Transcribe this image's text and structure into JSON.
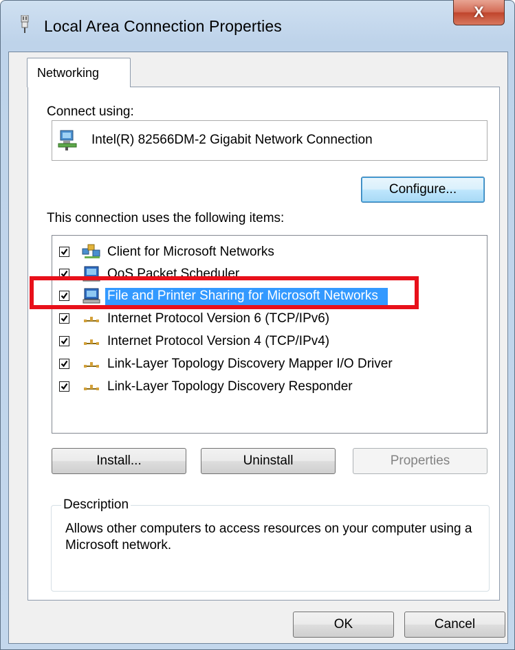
{
  "window": {
    "title": "Local Area Connection Properties",
    "close_glyph": "X"
  },
  "tabs": [
    {
      "label": "Networking",
      "selected": true
    }
  ],
  "connect_using": {
    "label": "Connect using:",
    "adapter": "Intel(R) 82566DM-2 Gigabit Network Connection",
    "configure_button": "Configure..."
  },
  "items_section": {
    "label": "This connection uses the following items:",
    "items": [
      {
        "label": "Client for Microsoft Networks",
        "checked": true,
        "icon": "network-client-icon",
        "selected": false
      },
      {
        "label": "QoS Packet Scheduler",
        "checked": true,
        "icon": "network-service-icon",
        "selected": false
      },
      {
        "label": "File and Printer Sharing for Microsoft Networks",
        "checked": true,
        "icon": "network-service-icon",
        "selected": true
      },
      {
        "label": "Internet Protocol Version 6 (TCP/IPv6)",
        "checked": true,
        "icon": "network-protocol-icon",
        "selected": false
      },
      {
        "label": "Internet Protocol Version 4 (TCP/IPv4)",
        "checked": true,
        "icon": "network-protocol-icon",
        "selected": false
      },
      {
        "label": "Link-Layer Topology Discovery Mapper I/O Driver",
        "checked": true,
        "icon": "network-protocol-icon",
        "selected": false
      },
      {
        "label": "Link-Layer Topology Discovery Responder",
        "checked": true,
        "icon": "network-protocol-icon",
        "selected": false
      }
    ]
  },
  "item_buttons": {
    "install": "Install...",
    "uninstall": "Uninstall",
    "properties": "Properties",
    "properties_enabled": false
  },
  "description": {
    "legend": "Description",
    "text": "Allows other computers to access resources on your computer using a Microsoft network."
  },
  "dialog_buttons": {
    "ok": "OK",
    "cancel": "Cancel"
  },
  "annotation": {
    "color": "#e8101a",
    "highlights": "File and Printer Sharing for Microsoft Networks"
  },
  "colors": {
    "selection": "#3399ff",
    "title_gradient": "#bed3ea",
    "close_button": "#c0452c"
  }
}
